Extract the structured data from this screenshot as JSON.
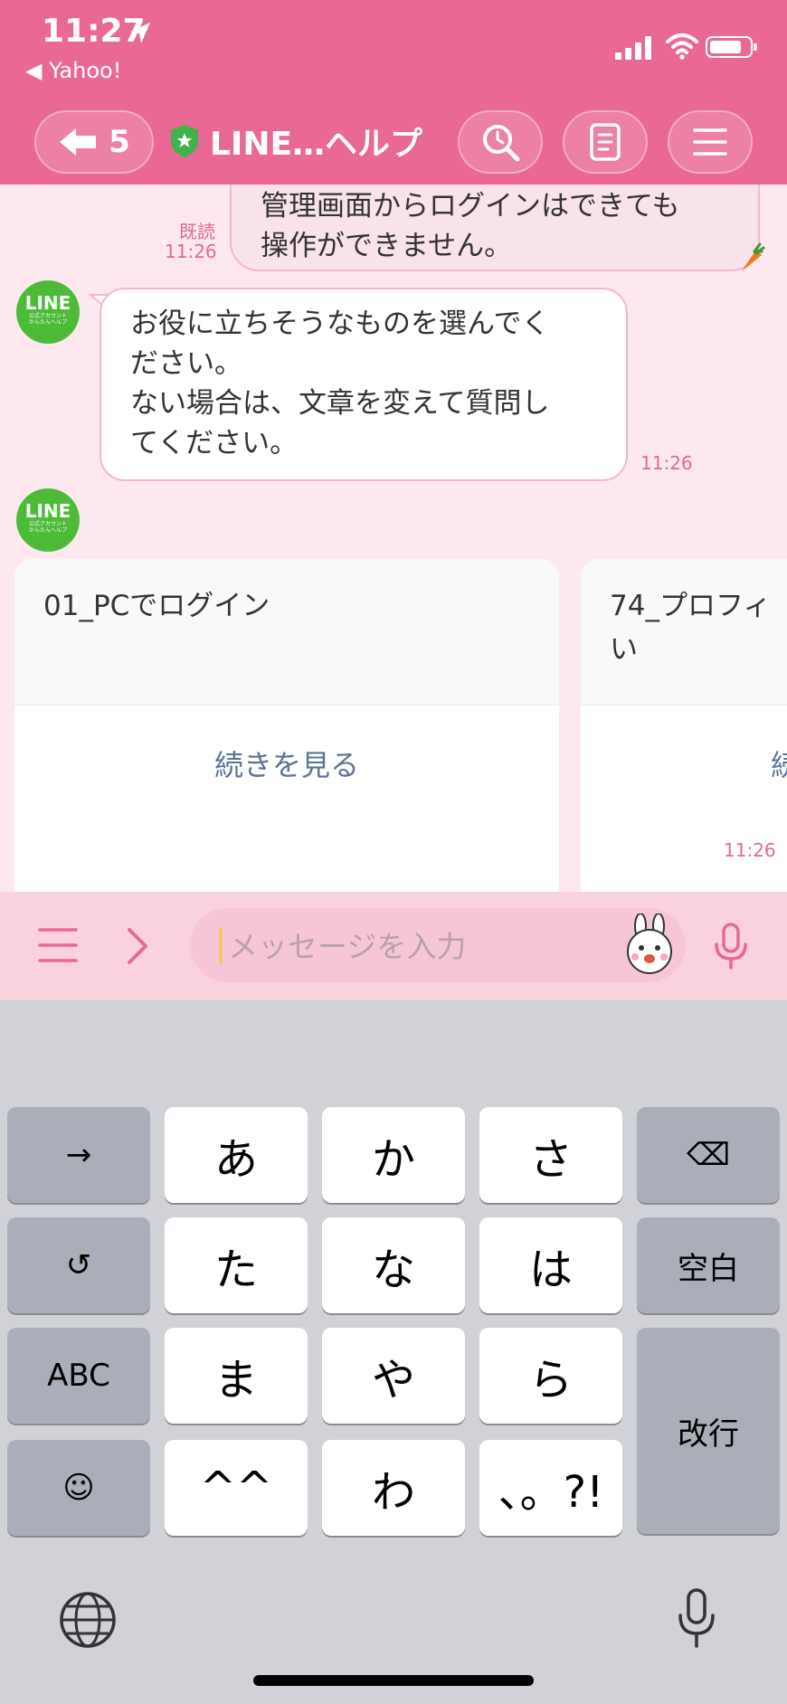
{
  "status_bar": {
    "time": "11:27",
    "back_app": "◀ Yahoo!"
  },
  "header": {
    "back_count": "5",
    "title": "LINE…ヘルプ"
  },
  "messages": {
    "user_message": "管理画面からログインはできても\n操作ができません。",
    "read_label": "既読",
    "user_time": "11:26",
    "bot_avatar": {
      "line1": "LINE",
      "line2": "公式アカウント\nかんたんヘルプ"
    },
    "bot_message": "お役に立ちそうなものを選んでく\nださい。\nない場合は、文章を変えて質問し\nてください。",
    "bot_time": "11:26",
    "cards": [
      {
        "title": "01_PCでログイン",
        "button": "続きを見る"
      },
      {
        "title": "74_プロフィ\nい",
        "button": "続"
      }
    ],
    "cards_time": "11:26"
  },
  "input": {
    "placeholder": "メッセージを入力"
  },
  "keyboard": {
    "row1": [
      "→",
      "あ",
      "か",
      "さ",
      "⌫"
    ],
    "row2": [
      "↺",
      "た",
      "な",
      "は",
      "空白"
    ],
    "row3": [
      "ABC",
      "ま",
      "や",
      "ら"
    ],
    "row4": [
      "☺",
      "^^",
      "わ",
      "、。?!"
    ],
    "return_key": "改行"
  },
  "colors": {
    "header": "#e96896",
    "accent": "#e06a98",
    "line_green": "#4cbb38"
  }
}
